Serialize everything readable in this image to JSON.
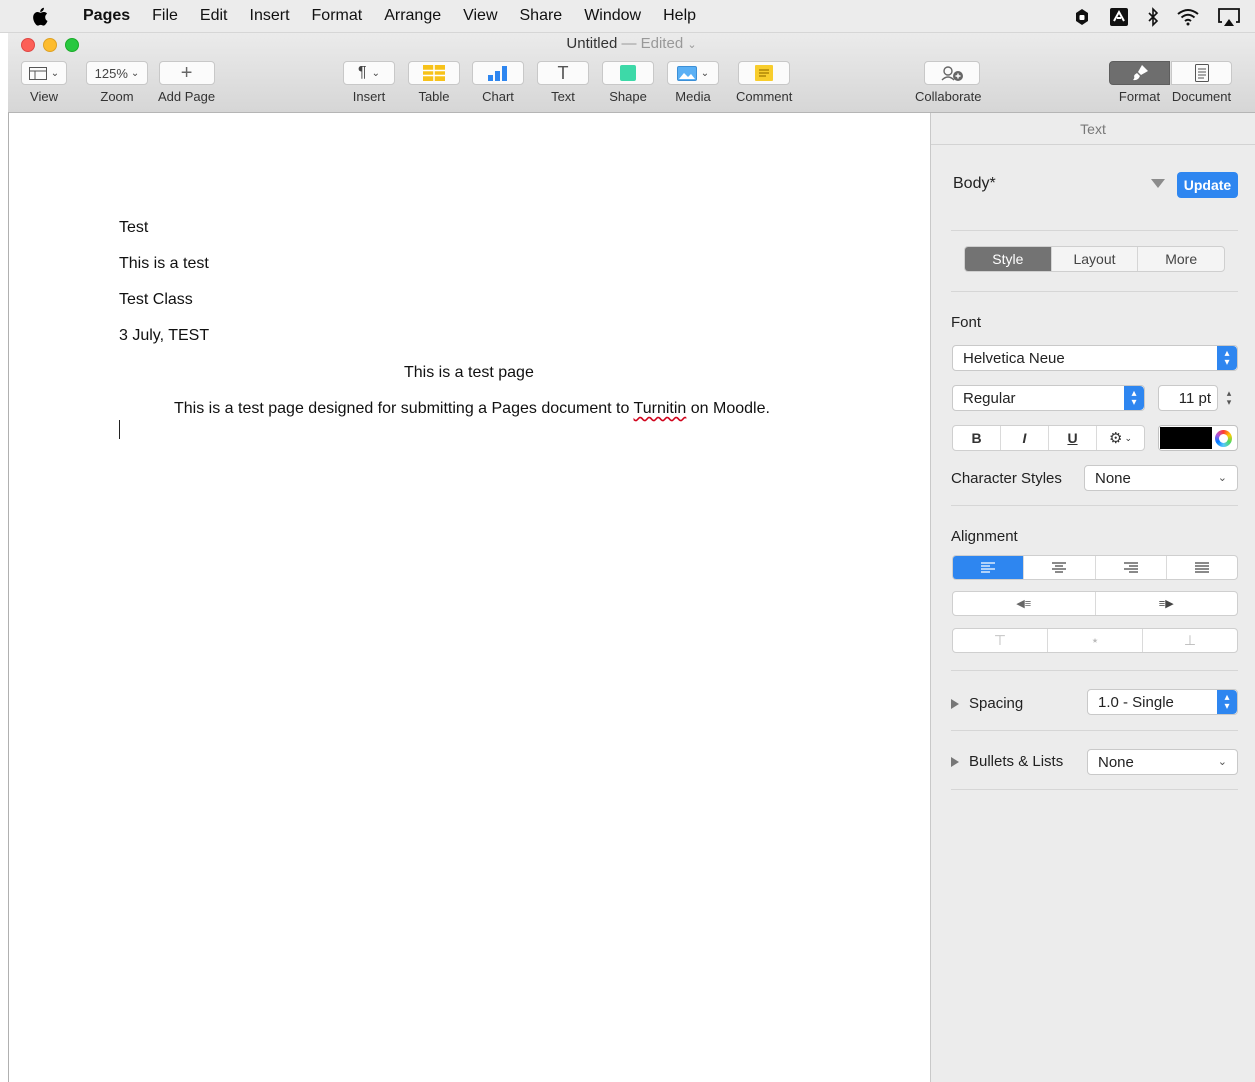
{
  "menubar": {
    "app": "Pages",
    "items": [
      "File",
      "Edit",
      "Insert",
      "Format",
      "Arrange",
      "View",
      "Share",
      "Window",
      "Help"
    ],
    "status_icons": [
      "hand-lock-icon",
      "adobe-icon",
      "bluetooth-icon",
      "wifi-icon",
      "airplay-icon"
    ]
  },
  "window": {
    "title": "Untitled",
    "separator": "—",
    "edited": "Edited"
  },
  "toolbar": {
    "view_label": "View",
    "zoom_value": "125%",
    "zoom_label": "Zoom",
    "add_page_label": "Add Page",
    "insert_label": "Insert",
    "table_label": "Table",
    "chart_label": "Chart",
    "text_label": "Text",
    "shape_label": "Shape",
    "media_label": "Media",
    "comment_label": "Comment",
    "collaborate_label": "Collaborate",
    "format_label": "Format",
    "document_label": "Document"
  },
  "document": {
    "lines": [
      "Test",
      "This is a test",
      "Test Class",
      "3 July, TEST"
    ],
    "title": "This is a test page",
    "body_before": "This is a test page designed for submitting a Pages document to ",
    "body_misspelled": "Turnitin",
    "body_after": " on Moodle."
  },
  "inspector": {
    "header": "Text",
    "paragraph_style": "Body*",
    "update_label": "Update",
    "tabs": [
      "Style",
      "Layout",
      "More"
    ],
    "font_label": "Font",
    "font_family": "Helvetica Neue",
    "font_weight": "Regular",
    "font_size": "11 pt",
    "bold": "B",
    "italic": "I",
    "underline": "U",
    "text_color": "#000000",
    "character_styles_label": "Character Styles",
    "character_styles_value": "None",
    "alignment_label": "Alignment",
    "spacing_label": "Spacing",
    "spacing_value": "1.0 - Single",
    "bullets_label": "Bullets & Lists",
    "bullets_value": "None"
  },
  "colors": {
    "accent": "#2e86f0",
    "spell_error": "#d0021b"
  }
}
